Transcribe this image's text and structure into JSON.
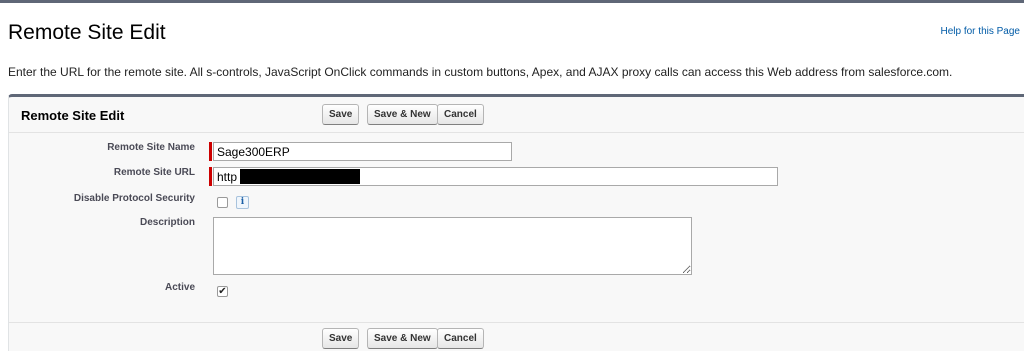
{
  "page": {
    "title": "Remote Site Edit",
    "help_link": "Help for this Page",
    "intro": "Enter the URL for the remote site. All s-controls, JavaScript OnClick commands in custom buttons, Apex, and AJAX proxy calls can access this Web address from salesforce.com."
  },
  "panel": {
    "title": "Remote Site Edit",
    "buttons": {
      "save": "Save",
      "save_new": "Save & New",
      "cancel": "Cancel"
    }
  },
  "form": {
    "remote_site_name": {
      "label": "Remote Site Name",
      "value": "Sage300ERP",
      "required": true
    },
    "remote_site_url": {
      "label": "Remote Site URL",
      "value": "http",
      "required": true,
      "redacted": true
    },
    "disable_protocol_security": {
      "label": "Disable Protocol Security",
      "checked": false,
      "info_icon": "info-icon"
    },
    "description": {
      "label": "Description",
      "value": ""
    },
    "active": {
      "label": "Active",
      "checked": true
    }
  },
  "colors": {
    "header_bar": "#5f6777",
    "required": "#cc0000",
    "link": "#015ba7",
    "panel_bg": "#f8f8f8"
  }
}
